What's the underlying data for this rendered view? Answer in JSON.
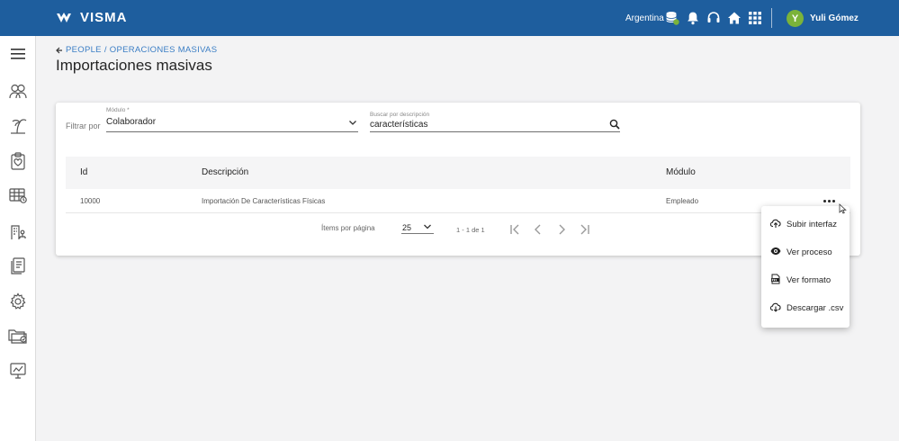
{
  "header": {
    "logo_text": "VISMA",
    "country": "Argentina",
    "user_initial": "Y",
    "user_name": "Yuli Gómez",
    "brand_color": "#1e5e9e"
  },
  "sidebar": {
    "items": [
      "menu-icon",
      "people-icon",
      "vacation-icon",
      "clipboard-icon",
      "calendar-table-icon",
      "org-chart-icon",
      "documents-icon",
      "gear-icon",
      "folders-icon",
      "monitor-icon"
    ]
  },
  "breadcrumb": {
    "parent": "PEOPLE",
    "separator": "/",
    "current": "OPERACIONES MASIVAS"
  },
  "page": {
    "title": "Importaciones masivas"
  },
  "filters": {
    "filter_label": "Filtrar por",
    "module_label": "Módulo *",
    "module_value": "Colaborador",
    "search_label": "Buscar por descripción",
    "search_value": "características"
  },
  "table": {
    "columns": [
      "Id",
      "Descripción",
      "Módulo"
    ],
    "rows": [
      {
        "id": "10000",
        "description": "Importación De Características Físicas",
        "module": "Empleado"
      }
    ]
  },
  "pagination": {
    "items_per_page_label": "Ítems por página",
    "page_size": "25",
    "range": "1 - 1 de 1"
  },
  "context_menu": {
    "items": [
      {
        "label": "Subir interfaz",
        "icon": "cloud-upload-icon"
      },
      {
        "label": "Ver proceso",
        "icon": "eye-icon"
      },
      {
        "label": "Ver formato",
        "icon": "csv-file-icon"
      },
      {
        "label": "Descargar .csv",
        "icon": "cloud-download-icon"
      }
    ]
  }
}
